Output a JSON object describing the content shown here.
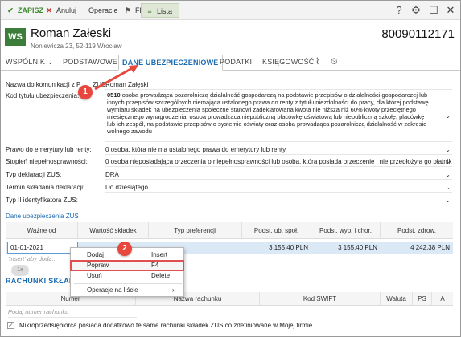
{
  "toolbar": {
    "save": "ZAPISZ",
    "cancel": "Anuluj",
    "operations": "Operacje",
    "flag": "Flaga",
    "list": "Lista",
    "help": "?",
    "settings": "⚙",
    "maximize": "☐",
    "close": "✕"
  },
  "header": {
    "logo": "WS",
    "name": "Roman Załęski",
    "address": "Noniewicza 23, 52-119 Wrocław",
    "id": "80090112171"
  },
  "tabs": {
    "partner": "WSPÓLNIK",
    "basic": "PODSTAWOWE",
    "insurance": "DANE UBEZPIECZENIOWE",
    "taxes": "PODATKI",
    "accounting": "KSIĘGOWOŚĆ"
  },
  "form": {
    "name_label": "Nazwa do komunikacji z P",
    "name_label_tail": "ZUS:",
    "name_value": "Roman Załęski",
    "code_label": "Kod tytułu ubezpieczenia:",
    "code_number": "0510",
    "code_text": "osoba prowadząca pozarolniczą działalność gospodarczą na podstawie przepisów o działalności gospodarczej lub innych przepisów szczególnych niemająca ustalonego prawa do renty z tytułu niezdolności do pracy, dla której podstawę wymiaru składek na ubezpieczenia społeczne stanowi zadeklarowana kwota nie niższa niż 60% kwoty przeciętnego miesięcznego wynagrodzenia, osoba prowadząca niepubliczną placówkę oświatową lub niepubliczną szkołę, placówkę lub ich zespół, na podstawie przepisów o systemie oświaty oraz osoba prowadząca pozarolniczą działalność w zakresie wolnego zawodu",
    "retirement_label": "Prawo do emerytury lub renty:",
    "retirement_value": "0  osoba, która nie ma ustalonego prawa do emerytury lub renty",
    "disability_label": "Stopień niepełnosprawności:",
    "disability_value": "0  osoba nieposiadająca orzeczenia o niepełnosprawności lub osoba, która posiada orzeczenie i nie przedłożyła go płatnik...",
    "decl_type_label": "Typ deklaracji ZUS:",
    "decl_type_value": "DRA",
    "deadline_label": "Termin składania deklaracji:",
    "deadline_value": "Do dziesiątego",
    "id_type_label": "Typ II identyfikatora ZUS:",
    "id_type_value": ""
  },
  "zus_section": {
    "title": "Dane ubezpieczenia ZUS",
    "columns": [
      "Ważne od",
      "Wartość składek",
      "Typ preferencji",
      "Podst. ub. społ.",
      "Podst. wyp. i chor.",
      "Podst. zdrow."
    ],
    "row": {
      "date": "01-01-2021",
      "value": "",
      "pref": "",
      "social": "3 155,40 PLN",
      "sick": "3 155,40 PLN",
      "health": "4 242,38 PLN"
    },
    "hint": "'Insert' aby doda..."
  },
  "context_menu": {
    "add": "Dodaj",
    "add_key": "Insert",
    "edit": "Popraw",
    "edit_key": "F4",
    "delete": "Usuń",
    "delete_key": "Delete",
    "list_ops": "Operacje na liście"
  },
  "accounts": {
    "title": "RACHUNKI SKŁAD",
    "columns": [
      "Numer",
      "Nazwa rachunku",
      "Kod SWIFT",
      "Waluta",
      "PS",
      "A"
    ],
    "placeholder": "Podaj numer rachunku",
    "checkbox_label": "Mikroprzedsiębiorca posiada dodatkowo te same rachunki składek ZUS co zdefiniowane w Mojej firmie"
  },
  "annotations": {
    "badge1": "1",
    "badge2": "2",
    "cursor": "1x"
  },
  "colors": {
    "accent": "#1a6ab0",
    "brand": "#3c7d3a",
    "annotation": "#e8473d",
    "selected_row": "#dbe9f7"
  }
}
